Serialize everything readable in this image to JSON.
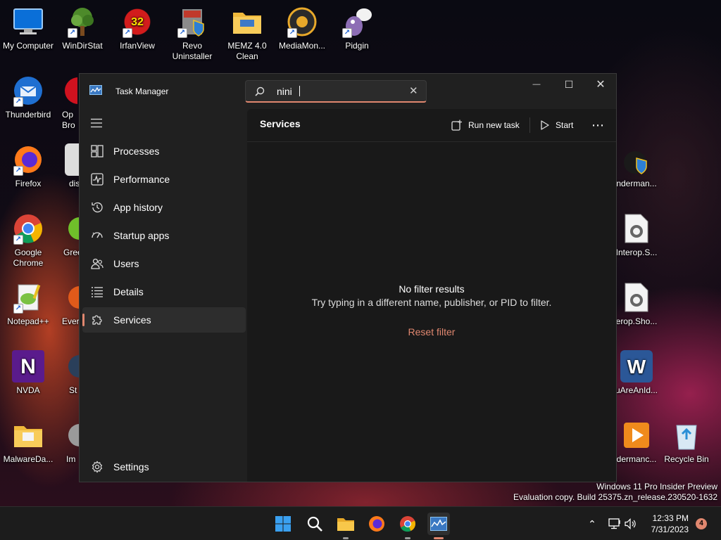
{
  "desktop": {
    "icons": [
      {
        "label": "My Computer",
        "glyph": ""
      },
      {
        "label": "WinDirStat",
        "glyph": ""
      },
      {
        "label": "IrfanView",
        "glyph": "32"
      },
      {
        "label": "Revo Uninstaller",
        "glyph": ""
      },
      {
        "label": "MEMZ 4.0 Clean",
        "glyph": ""
      },
      {
        "label": "MediaMon...",
        "glyph": ""
      },
      {
        "label": "Pidgin",
        "glyph": ""
      },
      {
        "label": "Thunderbird",
        "glyph": ""
      },
      {
        "label": "Op Bro",
        "glyph": ""
      },
      {
        "label": "Firefox",
        "glyph": ""
      },
      {
        "label": "dis",
        "glyph": ""
      },
      {
        "label": "Google Chrome",
        "glyph": ""
      },
      {
        "label": "Gree",
        "glyph": ""
      },
      {
        "label": "Notepad++",
        "glyph": ""
      },
      {
        "label": "Ever",
        "glyph": ""
      },
      {
        "label": "NVDA",
        "glyph": "N"
      },
      {
        "label": "St",
        "glyph": ""
      },
      {
        "label": "MalwareDa...",
        "glyph": ""
      },
      {
        "label": "Im",
        "glyph": ""
      },
      {
        "label": "nderman...",
        "glyph": ""
      },
      {
        "label": "Interop.S...",
        "glyph": ""
      },
      {
        "label": "erop.Sho...",
        "glyph": ""
      },
      {
        "label": "uAreAnId...",
        "glyph": "W"
      },
      {
        "label": "dermanc...",
        "glyph": ""
      },
      {
        "label": "Recycle Bin",
        "glyph": ""
      }
    ]
  },
  "window": {
    "title": "Task Manager",
    "search": {
      "value": "nini",
      "placeholder": ""
    },
    "clear_glyph": "✕",
    "minimize_glyph": "—",
    "maximize_glyph": "☐",
    "close_glyph": "✕"
  },
  "nav": {
    "items": [
      {
        "label": "Processes",
        "icon": "processes-grid-icon"
      },
      {
        "label": "Performance",
        "icon": "performance-chart-icon"
      },
      {
        "label": "App history",
        "icon": "history-clock-icon"
      },
      {
        "label": "Startup apps",
        "icon": "startup-gauge-icon"
      },
      {
        "label": "Users",
        "icon": "users-icon"
      },
      {
        "label": "Details",
        "icon": "details-list-icon"
      },
      {
        "label": "Services",
        "icon": "services-puzzle-icon"
      }
    ],
    "active_index": 6,
    "settings_label": "Settings"
  },
  "content": {
    "page_title": "Services",
    "run_new_task": "Run new task",
    "start": "Start",
    "more_glyph": "⋯",
    "empty_title": "No filter results",
    "empty_subtitle": "Try typing in a different name, publisher, or PID to filter.",
    "reset_filter": "Reset filter"
  },
  "watermark": {
    "line1": "Windows 11 Pro Insider Preview",
    "line2": "Evaluation copy. Build 25375.zn_release.230520-1632"
  },
  "taskbar": {
    "time": "12:33 PM",
    "date": "7/31/2023",
    "notification_count": "4",
    "tray_chevron": "⌃"
  },
  "colors": {
    "accent": "#e0876f",
    "window_bg": "#202020",
    "content_bg": "#191919"
  }
}
